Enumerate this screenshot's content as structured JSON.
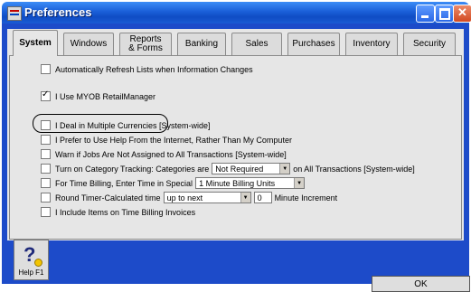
{
  "window": {
    "title": "Preferences",
    "colors": {
      "titlebar": "#1a5fd8",
      "frame": "#1d4bc9",
      "panel": "#e6e6e6"
    }
  },
  "tabs": [
    {
      "label": "System",
      "active": true
    },
    {
      "label": "Windows",
      "active": false
    },
    {
      "label": "Reports & Forms",
      "active": false
    },
    {
      "label": "Banking",
      "active": false
    },
    {
      "label": "Sales",
      "active": false
    },
    {
      "label": "Purchases",
      "active": false
    },
    {
      "label": "Inventory",
      "active": false
    },
    {
      "label": "Security",
      "active": false
    }
  ],
  "options": {
    "refresh_lists": {
      "label": "Automatically Refresh Lists when Information Changes",
      "checked": false
    },
    "retail_manager": {
      "label": "I Use MYOB RetailManager",
      "checked": true
    },
    "multi_currency": {
      "label": "I Deal in Multiple Currencies [System-wide]",
      "checked": false
    },
    "help_internet": {
      "label": "I Prefer to Use Help From the Internet, Rather Than My Computer",
      "checked": false
    },
    "warn_jobs": {
      "label": "Warn if Jobs Are Not Assigned to All Transactions [System-wide]",
      "checked": false
    },
    "category_tracking": {
      "label": "Turn on Category Tracking:  Categories are",
      "select_value": "Not Required",
      "suffix": "on All Transactions [System-wide]",
      "checked": false
    },
    "time_billing": {
      "label": "For Time Billing, Enter Time in Special",
      "select_value": "1 Minute Billing Units",
      "checked": false
    },
    "round_timer": {
      "label": "Round Timer-Calculated time",
      "select_value": "up to next",
      "increment_value": "0",
      "suffix": "Minute Increment",
      "checked": false
    },
    "include_items": {
      "label": "I Include Items on Time Billing Invoices",
      "checked": false
    }
  },
  "footer": {
    "help_label": "Help F1",
    "help_icon": "question-mark-help-icon",
    "ok_label": "OK"
  }
}
